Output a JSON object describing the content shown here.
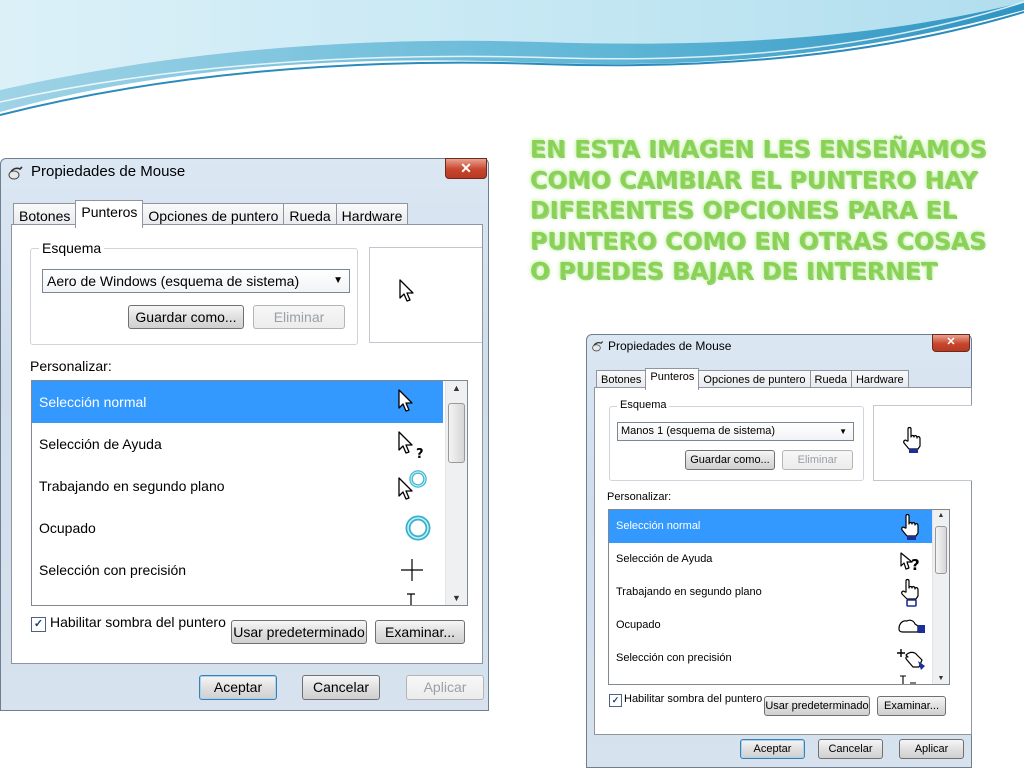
{
  "slide": {
    "headline": "EN ESTA IMAGEN LES ENSEÑAMOS COMO CAMBIAR EL PUNTERO HAY DIFERENTES OPCIONES PARA EL PUNTERO COMO EN OTRAS COSAS  O PUEDES BAJAR DE INTERNET",
    "accent_color": "#8ad158"
  },
  "dialogs": [
    {
      "title": "Propiedades de Mouse",
      "close_glyph": "✕",
      "tabs": [
        "Botones",
        "Punteros",
        "Opciones de puntero",
        "Rueda",
        "Hardware"
      ],
      "active_tab": "Punteros",
      "scheme_legend": "Esquema",
      "scheme_value": "Aero de Windows (esquema de sistema)",
      "save_as": "Guardar como...",
      "delete": "Eliminar",
      "preview_icon": "arrow-cursor-icon",
      "customize_label": "Personalizar:",
      "items": [
        {
          "label": "Selección normal",
          "icon": "arrow-cursor-icon",
          "selected": true
        },
        {
          "label": "Selección de Ayuda",
          "icon": "help-cursor-icon"
        },
        {
          "label": "Trabajando en segundo plano",
          "icon": "working-cursor-icon"
        },
        {
          "label": "Ocupado",
          "icon": "busy-ring-icon"
        },
        {
          "label": "Selección con precisión",
          "icon": "crosshair-icon"
        }
      ],
      "shadow_checkbox": "Habilitar sombra del puntero",
      "shadow_checked": true,
      "check_glyph": "✓",
      "use_default": "Usar predeterminado",
      "browse": "Examinar...",
      "ok": "Aceptar",
      "cancel": "Cancelar",
      "apply": "Aplicar",
      "apply_disabled": true
    },
    {
      "title": "Propiedades de Mouse",
      "close_glyph": "✕",
      "tabs": [
        "Botones",
        "Punteros",
        "Opciones de puntero",
        "Rueda",
        "Hardware"
      ],
      "active_tab": "Punteros",
      "scheme_legend": "Esquema",
      "scheme_value": "Manos 1 (esquema de sistema)",
      "save_as": "Guardar como...",
      "delete": "Eliminar",
      "preview_icon": "hand-cursor-icon",
      "customize_label": "Personalizar:",
      "items": [
        {
          "label": "Selección normal",
          "icon": "hand-cursor-icon",
          "selected": true
        },
        {
          "label": "Selección de Ayuda",
          "icon": "hand-help-cursor-icon"
        },
        {
          "label": "Trabajando en segundo plano",
          "icon": "hand-working-cursor-icon"
        },
        {
          "label": "Ocupado",
          "icon": "hand-busy-cursor-icon"
        },
        {
          "label": "Selección con precisión",
          "icon": "hand-precision-cursor-icon"
        }
      ],
      "shadow_checkbox": "Habilitar sombra del puntero",
      "shadow_checked": true,
      "check_glyph": "✓",
      "use_default": "Usar predeterminado",
      "browse": "Examinar...",
      "ok": "Aceptar",
      "cancel": "Cancelar",
      "apply": "Aplicar",
      "apply_disabled": false
    }
  ]
}
